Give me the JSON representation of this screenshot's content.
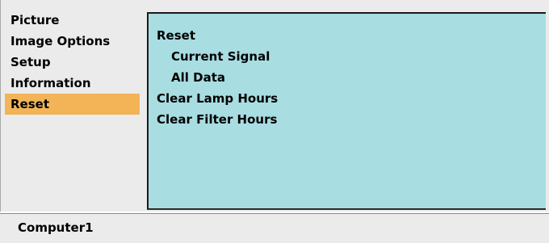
{
  "main_menu": {
    "items": [
      {
        "label": "Picture"
      },
      {
        "label": "Image Options"
      },
      {
        "label": "Setup"
      },
      {
        "label": "Information"
      },
      {
        "label": "Reset",
        "selected": true
      }
    ]
  },
  "submenu": {
    "items": [
      {
        "label": "Reset"
      },
      {
        "label": "Current Signal"
      },
      {
        "label": "All Data"
      },
      {
        "label": "Clear Lamp Hours"
      },
      {
        "label": "Clear Filter Hours"
      }
    ]
  },
  "status_bar": {
    "source": "Computer1"
  },
  "colors": {
    "menu_background": "#ebebeb",
    "selected_highlight": "#f2b457",
    "submenu_background": "#a8dde2"
  }
}
